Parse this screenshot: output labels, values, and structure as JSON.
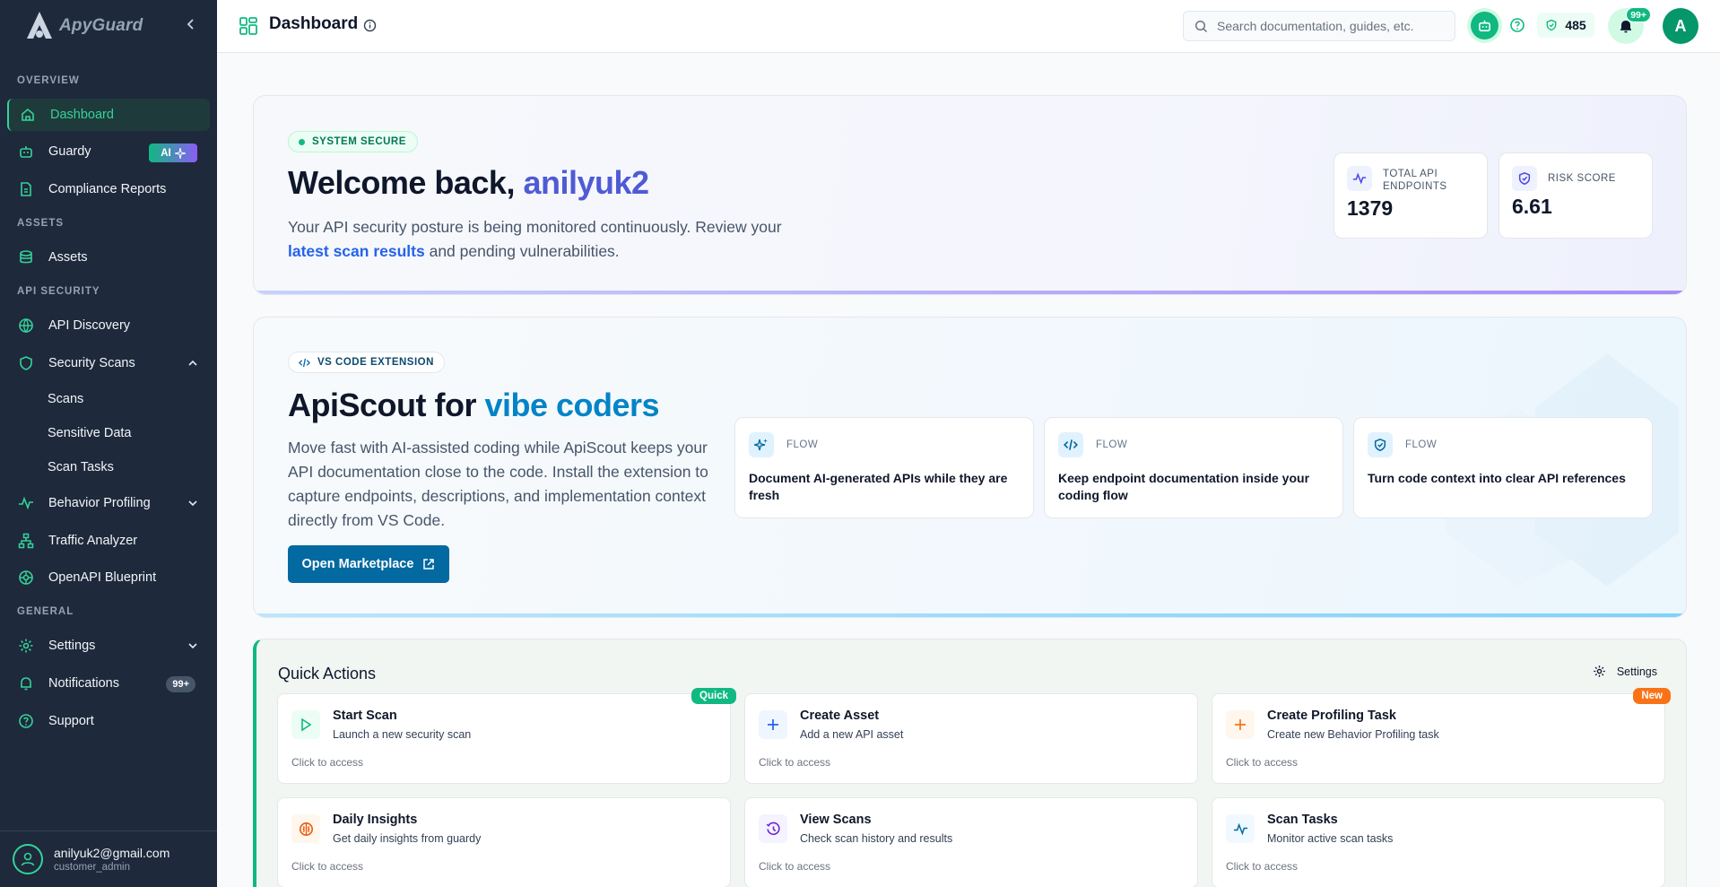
{
  "brand": {
    "name": "ApyGuard"
  },
  "sidebar": {
    "sections": {
      "overview": "OVERVIEW",
      "assets": "ASSETS",
      "api_security": "API SECURITY",
      "general": "GENERAL"
    },
    "items": {
      "dashboard": "Dashboard",
      "guardy": "Guardy",
      "guardy_badge": "AI",
      "compliance": "Compliance Reports",
      "assets": "Assets",
      "api_discovery": "API Discovery",
      "security_scans": "Security Scans",
      "scans": "Scans",
      "sensitive_data": "Sensitive Data",
      "scan_tasks": "Scan Tasks",
      "behavior_profiling": "Behavior Profiling",
      "traffic_analyzer": "Traffic Analyzer",
      "openapi_blueprint": "OpenAPI Blueprint",
      "settings": "Settings",
      "notifications": "Notifications",
      "notifications_badge": "99+",
      "support": "Support"
    },
    "user": {
      "email": "anilyuk2@gmail.com",
      "role": "customer_admin"
    }
  },
  "header": {
    "title": "Dashboard",
    "search_placeholder": "Search documentation, guides, etc.",
    "credits": "485",
    "notifications_badge": "99+",
    "avatar_letter": "A"
  },
  "welcome": {
    "status": "SYSTEM SECURE",
    "greeting": "Welcome back, ",
    "username": "anilyuk2",
    "text_1": "Your API security posture is being monitored continuously. Review your ",
    "link": "latest scan results",
    "text_2": " and pending vulnerabilities.",
    "stats": [
      {
        "label": "TOTAL API ENDPOINTS",
        "value": "1379"
      },
      {
        "label": "RISK SCORE",
        "value": "6.61"
      }
    ]
  },
  "promo": {
    "tag": "VS CODE EXTENSION",
    "title_1": "ApiScout for ",
    "title_2": "vibe coders",
    "description": "Move fast with AI-assisted coding while ApiScout keeps your API documentation close to the code. Install the extension to capture endpoints, descriptions, and implementation context directly from VS Code.",
    "button": "Open Marketplace",
    "flows": [
      {
        "tag": "FLOW",
        "text": "Document AI-generated APIs while they are fresh"
      },
      {
        "tag": "FLOW",
        "text": "Keep endpoint documentation inside your coding flow"
      },
      {
        "tag": "FLOW",
        "text": "Turn code context into clear API references"
      }
    ]
  },
  "quick_actions": {
    "title": "Quick Actions",
    "settings": "Settings",
    "access_hint": "Click to access",
    "items": [
      {
        "title": "Start Scan",
        "desc": "Launch a new security scan",
        "badge": "Quick"
      },
      {
        "title": "Create Asset",
        "desc": "Add a new API asset"
      },
      {
        "title": "Create Profiling Task",
        "desc": "Create new Behavior Profiling task",
        "badge": "New"
      },
      {
        "title": "Daily Insights",
        "desc": "Get daily insights from guardy"
      },
      {
        "title": "View Scans",
        "desc": "Check scan history and results"
      },
      {
        "title": "Scan Tasks",
        "desc": "Monitor active scan tasks"
      }
    ]
  },
  "colors": {
    "accent": "#10b981",
    "sidebar": "#1e293b",
    "brand_blue": "#4f5bd5",
    "promo_blue": "#0284c7",
    "badge_orange": "#f97316"
  }
}
